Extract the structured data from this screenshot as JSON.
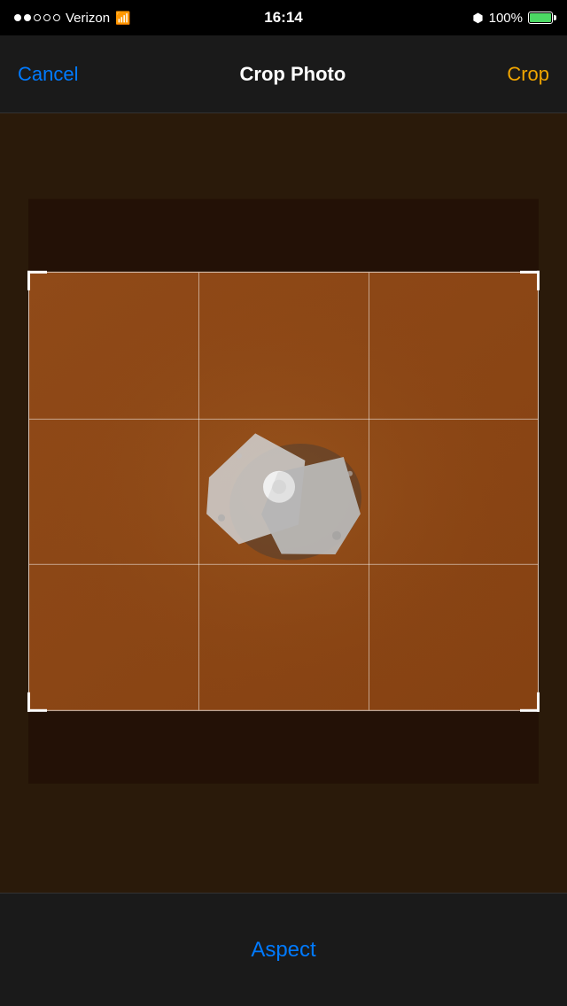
{
  "status_bar": {
    "signal_filled": 2,
    "signal_empty": 3,
    "carrier": "Verizon",
    "wifi": true,
    "time": "16:14",
    "bluetooth": true,
    "battery_percent": "100%",
    "battery_level": 100
  },
  "nav": {
    "cancel_label": "Cancel",
    "title": "Crop Photo",
    "crop_label": "Crop"
  },
  "bottom_bar": {
    "aspect_label": "Aspect"
  }
}
